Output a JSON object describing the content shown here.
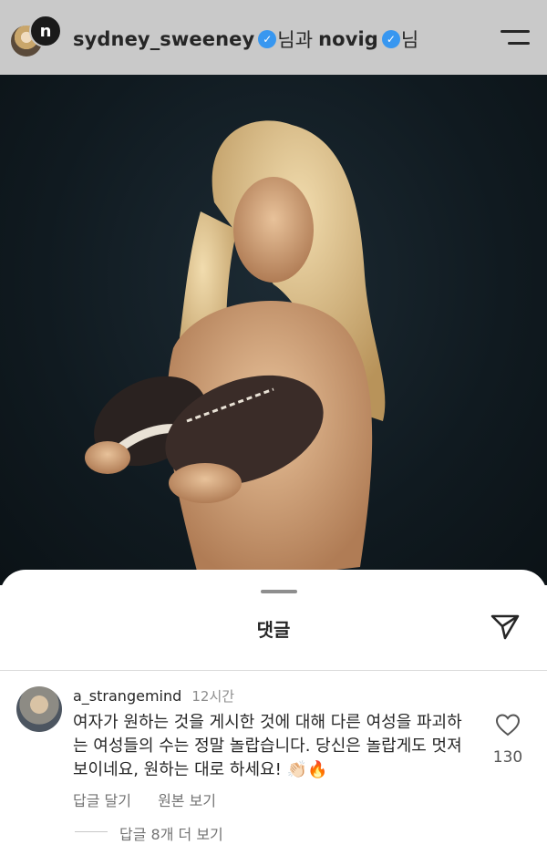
{
  "header": {
    "username": "sydney_sweeney",
    "joiner": "님과",
    "collaborator": "novig",
    "suffix": "님",
    "second_avatar_glyph": "n"
  },
  "comments_sheet": {
    "title": "댓글"
  },
  "comment": {
    "username": "a_strangemind",
    "time": "12시간",
    "text": "여자가 원하는 것을 게시한 것에 대해 다른 여성을 파괴하는 여성들의 수는 정말 놀랍습니다. 당신은 놀랍게도 멋져 보이네요, 원하는 대로 하세요! 👏🏻🔥",
    "like_count": "130",
    "reply_label": "답글 달기",
    "see_original_label": "원본 보기",
    "view_replies_label": "답글 8개 더 보기"
  },
  "colors": {
    "verified": "#3897f0",
    "header_bg": "#c9c9c9",
    "photo_bg": "#101a20"
  }
}
